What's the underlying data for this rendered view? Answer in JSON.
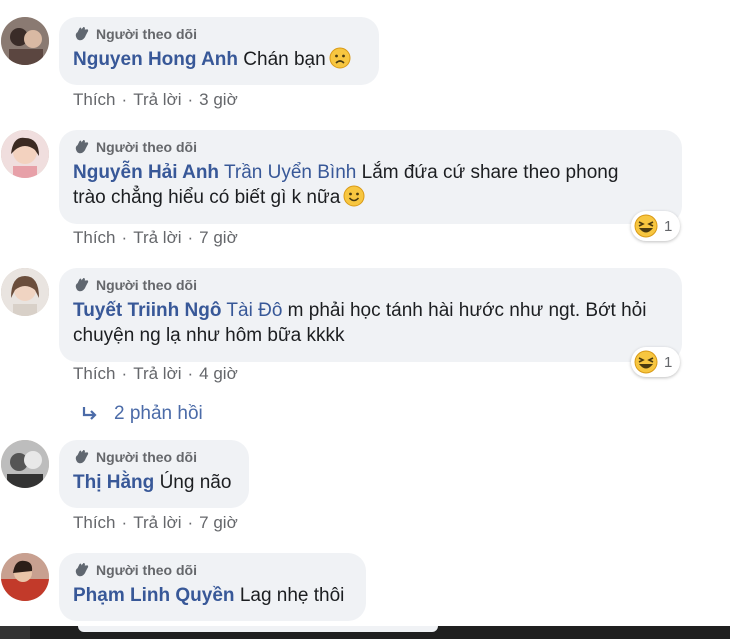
{
  "comments": [
    {
      "badge": "Người theo dõi",
      "author": "Nguyen Hong Anh",
      "tag": "",
      "text": "Chán bạn",
      "emoji": "sad-face",
      "actions": {
        "like": "Thích",
        "reply": "Trả lời",
        "time": "3 giờ"
      },
      "reaction": null
    },
    {
      "badge": "Người theo dõi",
      "author": "Nguyễn Hải Anh",
      "tag": "Trần Uyển Bình",
      "text_line1": "Lắm đứa cứ share theo phong",
      "text_line2": "trào chẳng hiểu có biết gì k nữa",
      "emoji": "smile-face",
      "actions": {
        "like": "Thích",
        "reply": "Trả lời",
        "time": "7 giờ"
      },
      "reaction": {
        "type": "haha",
        "count": "1"
      }
    },
    {
      "badge": "Người theo dõi",
      "author": "Tuyết Triinh Ngô",
      "tag": "Tài Đô",
      "text_line1": "m phải học tánh hài hước như ngt. Bớt hỏi",
      "text_line2": "chuyện ng lạ như hôm bữa kkkk",
      "actions": {
        "like": "Thích",
        "reply": "Trả lời",
        "time": "4 giờ"
      },
      "reaction": {
        "type": "haha",
        "count": "1"
      }
    },
    {
      "badge": "Người theo dõi",
      "author": "Thị Hằng",
      "text": "Úng não",
      "actions": {
        "like": "Thích",
        "reply": "Trả lời",
        "time": "7 giờ"
      }
    },
    {
      "badge": "Người theo dõi",
      "author": "Phạm Linh Quyền",
      "text": "Lag nhẹ thôi"
    }
  ],
  "replies_link": "2 phản hồi",
  "colors": {
    "author": "#385898",
    "bubble": "#f0f2f5",
    "meta": "#65676b",
    "link": "#4b6ba8"
  },
  "icons": {
    "badge": "hand-wave-icon",
    "reply_arrow": "reply-arrow-icon",
    "reaction": "haha-emoji-icon"
  }
}
